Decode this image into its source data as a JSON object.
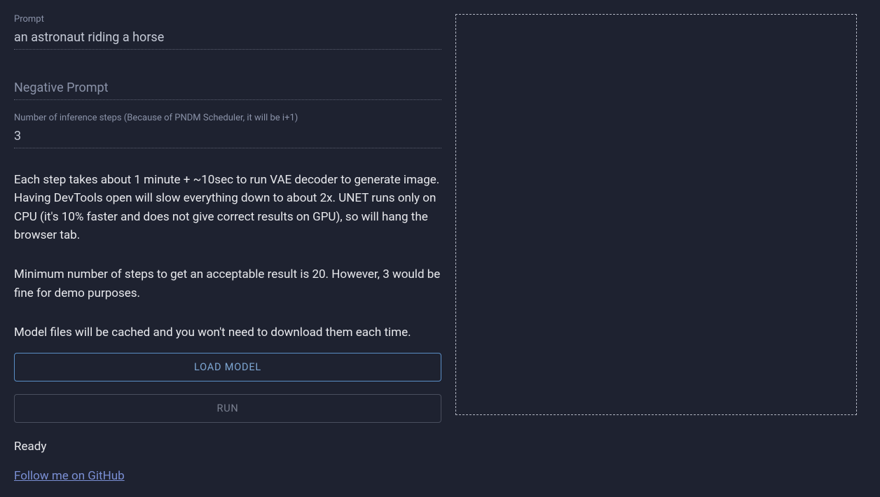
{
  "prompt": {
    "label": "Prompt",
    "value": "an astronaut riding a horse"
  },
  "negativePrompt": {
    "placeholder": "Negative Prompt",
    "value": ""
  },
  "steps": {
    "label": "Number of inference steps (Because of PNDM Scheduler, it will be i+1)",
    "value": "3"
  },
  "info": {
    "paragraph1": "Each step takes about 1 minute + ~10sec to run VAE decoder to generate image. Having DevTools open will slow everything down to about 2x. UNET runs only on CPU (it's 10% faster and does not give correct results on GPU), so will hang the browser tab.",
    "paragraph2": "Minimum number of steps to get an acceptable result is 20. However, 3 would be fine for demo purposes.",
    "paragraph3": "Model files will be cached and you won't need to download them each time."
  },
  "buttons": {
    "loadModel": "LOAD MODEL",
    "run": "RUN"
  },
  "status": "Ready",
  "link": "Follow me on GitHub"
}
